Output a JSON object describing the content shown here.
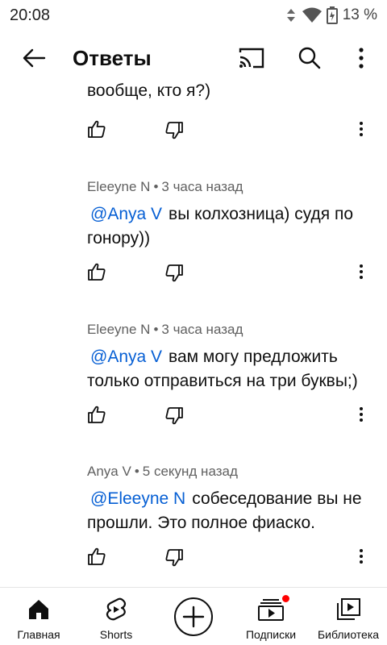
{
  "status_bar": {
    "time": "20:08",
    "battery": "13 %"
  },
  "header": {
    "title": "Ответы",
    "icons": [
      "back-arrow-icon",
      "cast-icon",
      "search-icon",
      "more-vertical-icon"
    ]
  },
  "partial_comment": {
    "text": "вообще, кто я?)"
  },
  "comments": [
    {
      "author": "Eleeyne N",
      "time": "3 часа назад",
      "mention": "@Anya V",
      "text_line1": "вы колхозница) судя по",
      "text_line2": "гонору))"
    },
    {
      "author": "Eleeyne N",
      "time": "3 часа назад",
      "mention": "@Anya V",
      "text_line1": "вам могу предложить",
      "text_line2": "только отправиться на три буквы;)"
    },
    {
      "author": "Anya V",
      "time": "5 секунд назад",
      "mention": "@Eleeyne N",
      "text_line1": "собеседование вы не",
      "text_line2": "прошли. Это полное фиаско."
    }
  ],
  "separator": "•",
  "bottom_nav": {
    "items": [
      {
        "label": "Главная",
        "icon": "home-icon"
      },
      {
        "label": "Shorts",
        "icon": "shorts-icon"
      },
      {
        "label": "",
        "icon": "create-plus-icon"
      },
      {
        "label": "Подписки",
        "icon": "subscriptions-icon"
      },
      {
        "label": "Библиотека",
        "icon": "library-icon"
      }
    ]
  },
  "colors": {
    "mention": "#065fd4",
    "meta": "#606060",
    "notification_dot": "#ff0000"
  }
}
